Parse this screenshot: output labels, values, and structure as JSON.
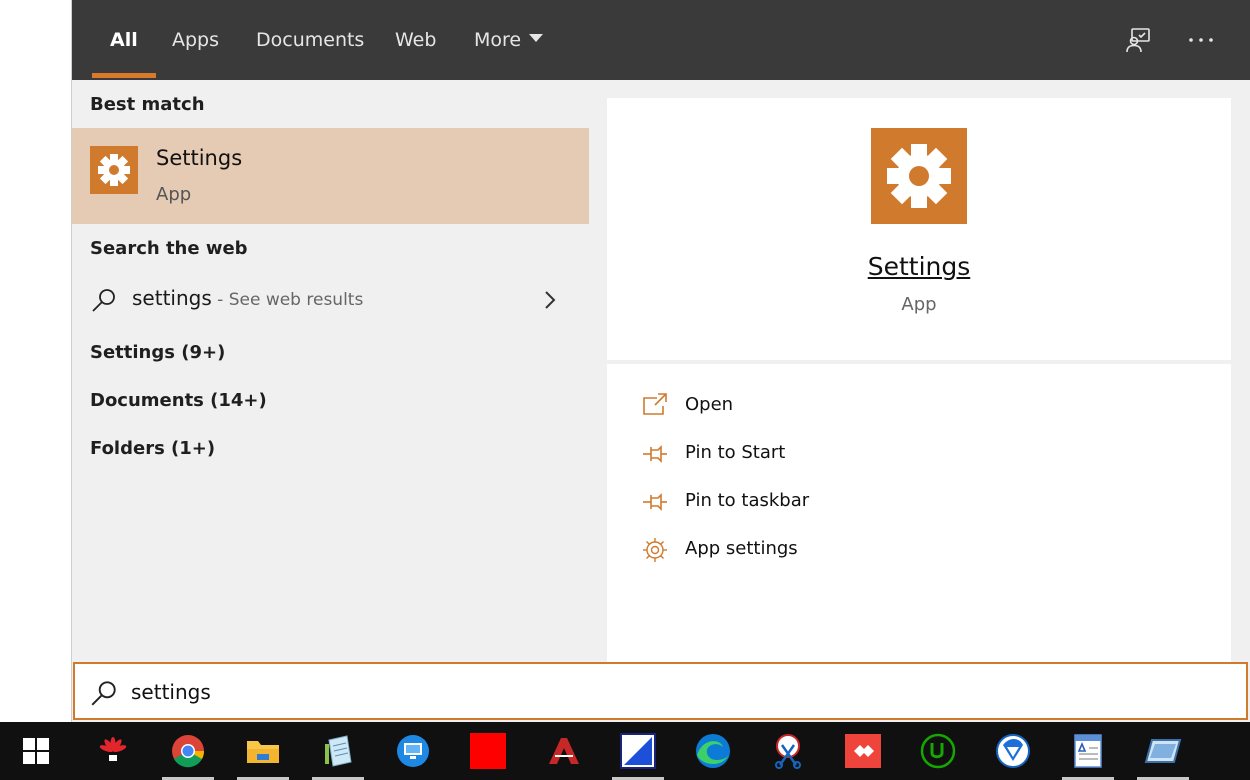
{
  "tabs": [
    {
      "label": "All"
    },
    {
      "label": "Apps"
    },
    {
      "label": "Documents"
    },
    {
      "label": "Web"
    },
    {
      "label": "More"
    }
  ],
  "top_icons": {
    "feedback": "feedback-icon",
    "more": "more-options-icon"
  },
  "left": {
    "best_match_header": "Best match",
    "best_match": {
      "title": "Settings",
      "subtitle": "App",
      "icon": "gear-icon"
    },
    "search_web_header": "Search the web",
    "web_result": {
      "query": "settings",
      "hint": " - See web results"
    },
    "groups": [
      {
        "label": "Settings (9+)"
      },
      {
        "label": "Documents (14+)"
      },
      {
        "label": "Folders (1+)"
      }
    ]
  },
  "right": {
    "title": "Settings",
    "subtitle": "App",
    "actions": [
      {
        "label": "Open",
        "icon": "open-icon"
      },
      {
        "label": "Pin to Start",
        "icon": "pin-icon"
      },
      {
        "label": "Pin to taskbar",
        "icon": "pin-icon"
      },
      {
        "label": "App settings",
        "icon": "gear-icon"
      }
    ]
  },
  "search": {
    "value": "settings"
  },
  "colors": {
    "accent": "#d07a2e",
    "selected": "#e5cbb4",
    "topbar": "#3a3a3a",
    "taskbar": "#101010"
  },
  "taskbar_apps": [
    "windows-start-icon",
    "huawei-icon",
    "chrome-icon",
    "file-explorer-icon",
    "notepad-icon",
    "remote-desktop-icon",
    "red-square-app-icon",
    "acrobat-icon",
    "paint-icon",
    "edge-icon",
    "snipping-icon",
    "anydesk-icon",
    "upwork-icon",
    "vpn-icon",
    "wordpad-icon",
    "tablet-app-icon"
  ]
}
